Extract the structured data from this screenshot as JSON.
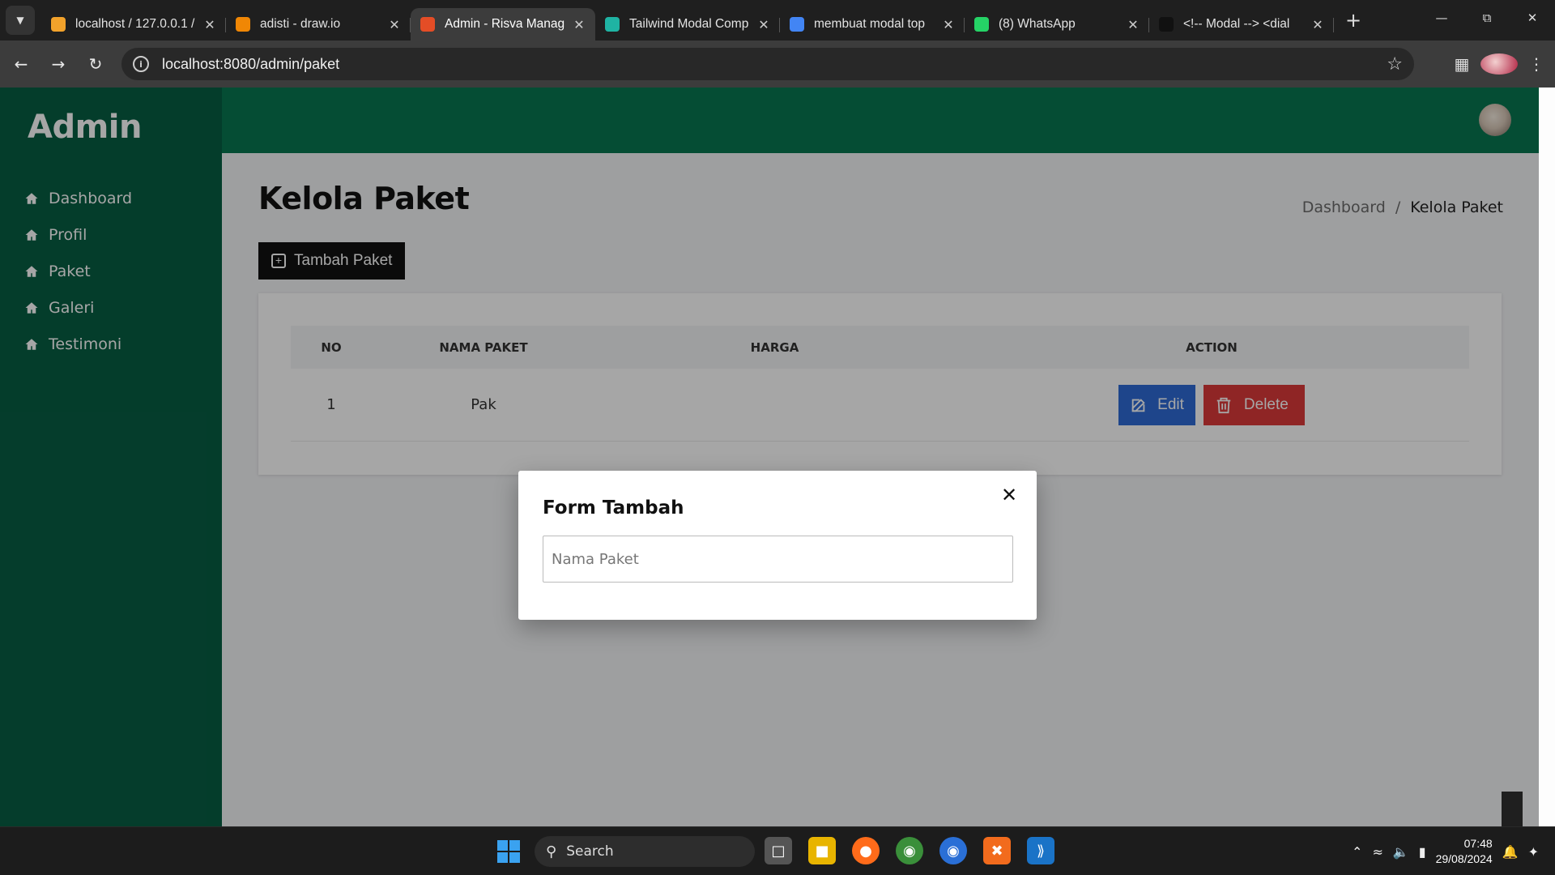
{
  "browser": {
    "tabs": [
      {
        "title": "localhost / 127.0.0.1 /",
        "favicon_color": "#f2a22b",
        "active": false
      },
      {
        "title": "adisti - draw.io",
        "favicon_color": "#f08705",
        "active": false
      },
      {
        "title": "Admin - Risva Manag",
        "favicon_color": "#e44d26",
        "active": true
      },
      {
        "title": "Tailwind Modal Comp",
        "favicon_color": "#1fb3a3",
        "active": false
      },
      {
        "title": "membuat modal top",
        "favicon_color": "#4285f4",
        "active": false
      },
      {
        "title": "(8) WhatsApp",
        "favicon_color": "#25d366",
        "active": false
      },
      {
        "title": "<!-- Modal --> <dial",
        "favicon_color": "#111111",
        "active": false
      }
    ],
    "url": "localhost:8080/admin/paket"
  },
  "sidebar": {
    "brand": "Admin",
    "items": [
      {
        "label": "Dashboard",
        "icon": "home-icon"
      },
      {
        "label": "Profil",
        "icon": "home-icon"
      },
      {
        "label": "Paket",
        "icon": "home-icon"
      },
      {
        "label": "Galeri",
        "icon": "home-icon"
      },
      {
        "label": "Testimoni",
        "icon": "home-icon"
      }
    ]
  },
  "header": {
    "avatar": "user-avatar"
  },
  "main": {
    "title": "Kelola Paket",
    "breadcrumb": {
      "parent": "Dashboard",
      "separator": "/",
      "current": "Kelola Paket"
    },
    "add_button": "Tambah Paket",
    "table": {
      "headers": [
        "NO",
        "NAMA PAKET",
        "HARGA",
        "ACTION"
      ],
      "rows": [
        {
          "no": "1",
          "nama": "Pak",
          "harga": "",
          "edit": "Edit",
          "delete": "Delete"
        }
      ]
    }
  },
  "modal": {
    "title": "Form Tambah",
    "input_placeholder": "Nama Paket",
    "input_value": ""
  },
  "taskbar": {
    "search_label": "Search",
    "time": "07:48",
    "date": "29/08/2024"
  },
  "colors": {
    "sidebar": "#075e43",
    "topbar": "#087751",
    "edit": "#2f6bd6",
    "delete": "#dc3a3a"
  }
}
